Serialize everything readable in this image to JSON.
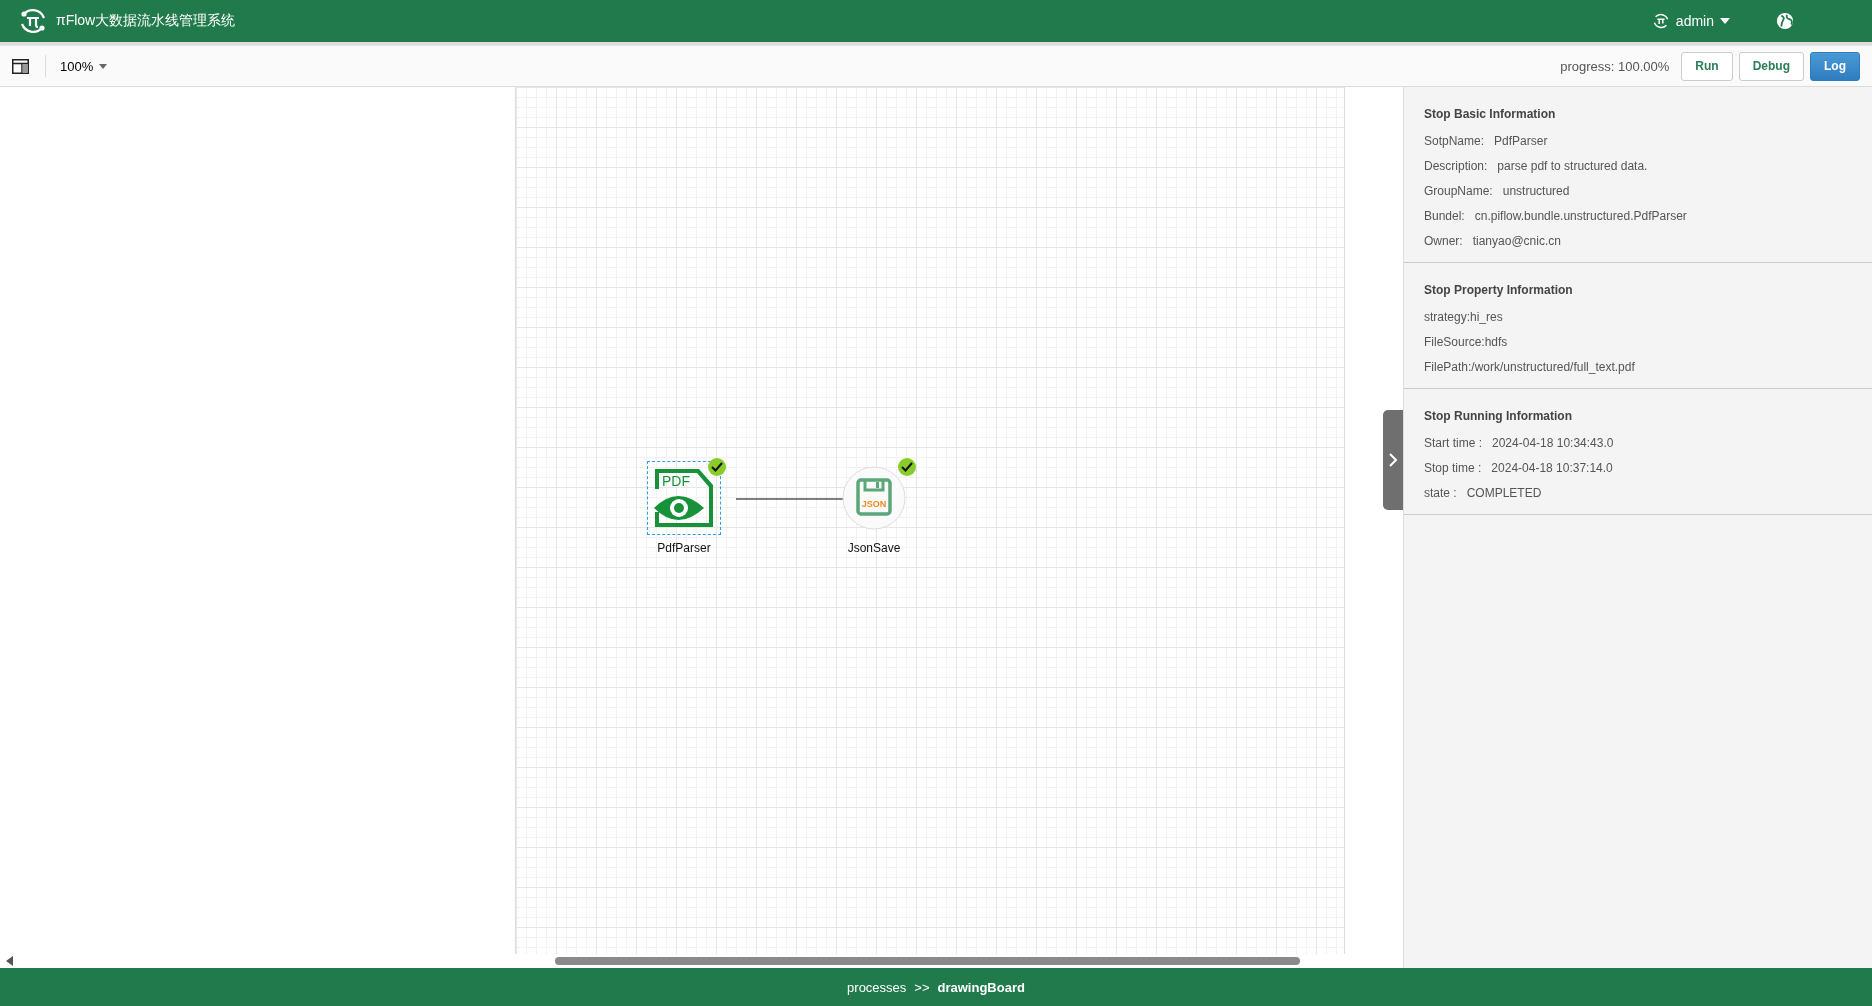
{
  "header": {
    "title": "πFlow大数据流水线管理系统",
    "user": "admin"
  },
  "toolbar": {
    "zoom": "100%",
    "progress_label": "progress:",
    "progress_value": "100.00%",
    "buttons": [
      {
        "label": "Run",
        "kind": "plain"
      },
      {
        "label": "Debug",
        "kind": "plain"
      },
      {
        "label": "Log",
        "kind": "primary"
      }
    ]
  },
  "nodes": [
    {
      "name": "PdfParser",
      "kind": "pdf",
      "icon_text": "PDF",
      "completed": true,
      "selected": true
    },
    {
      "name": "JsonSave",
      "kind": "json",
      "icon_text": "JSON",
      "completed": true,
      "selected": false
    }
  ],
  "panel": {
    "sections": [
      {
        "title": "Stop Basic Information",
        "rows": [
          {
            "label": "SotpName:",
            "value": "PdfParser"
          },
          {
            "label": "Description:",
            "value": "parse pdf to structured data."
          },
          {
            "label": "GroupName:",
            "value": "unstructured"
          },
          {
            "label": "Bundel:",
            "value": "cn.piflow.bundle.unstructured.PdfParser"
          },
          {
            "label": "Owner:",
            "value": "tianyao@cnic.cn"
          }
        ]
      },
      {
        "title": "Stop Property Information",
        "rows": [
          {
            "label": "strategy:hi_res"
          },
          {
            "label": "FileSource:hdfs"
          },
          {
            "label": "FilePath:/work/unstructured/full_text.pdf"
          }
        ]
      },
      {
        "title": "Stop Running Information",
        "rows": [
          {
            "label": "Start time :",
            "value": "2024-04-18 10:34:43.0"
          },
          {
            "label": "Stop time :",
            "value": "2024-04-18 10:37:14.0"
          },
          {
            "label": "state :",
            "value": "COMPLETED"
          }
        ]
      }
    ]
  },
  "footer": {
    "crumbs": [
      "processes",
      ">>"
    ],
    "current": "drawingBoard"
  }
}
